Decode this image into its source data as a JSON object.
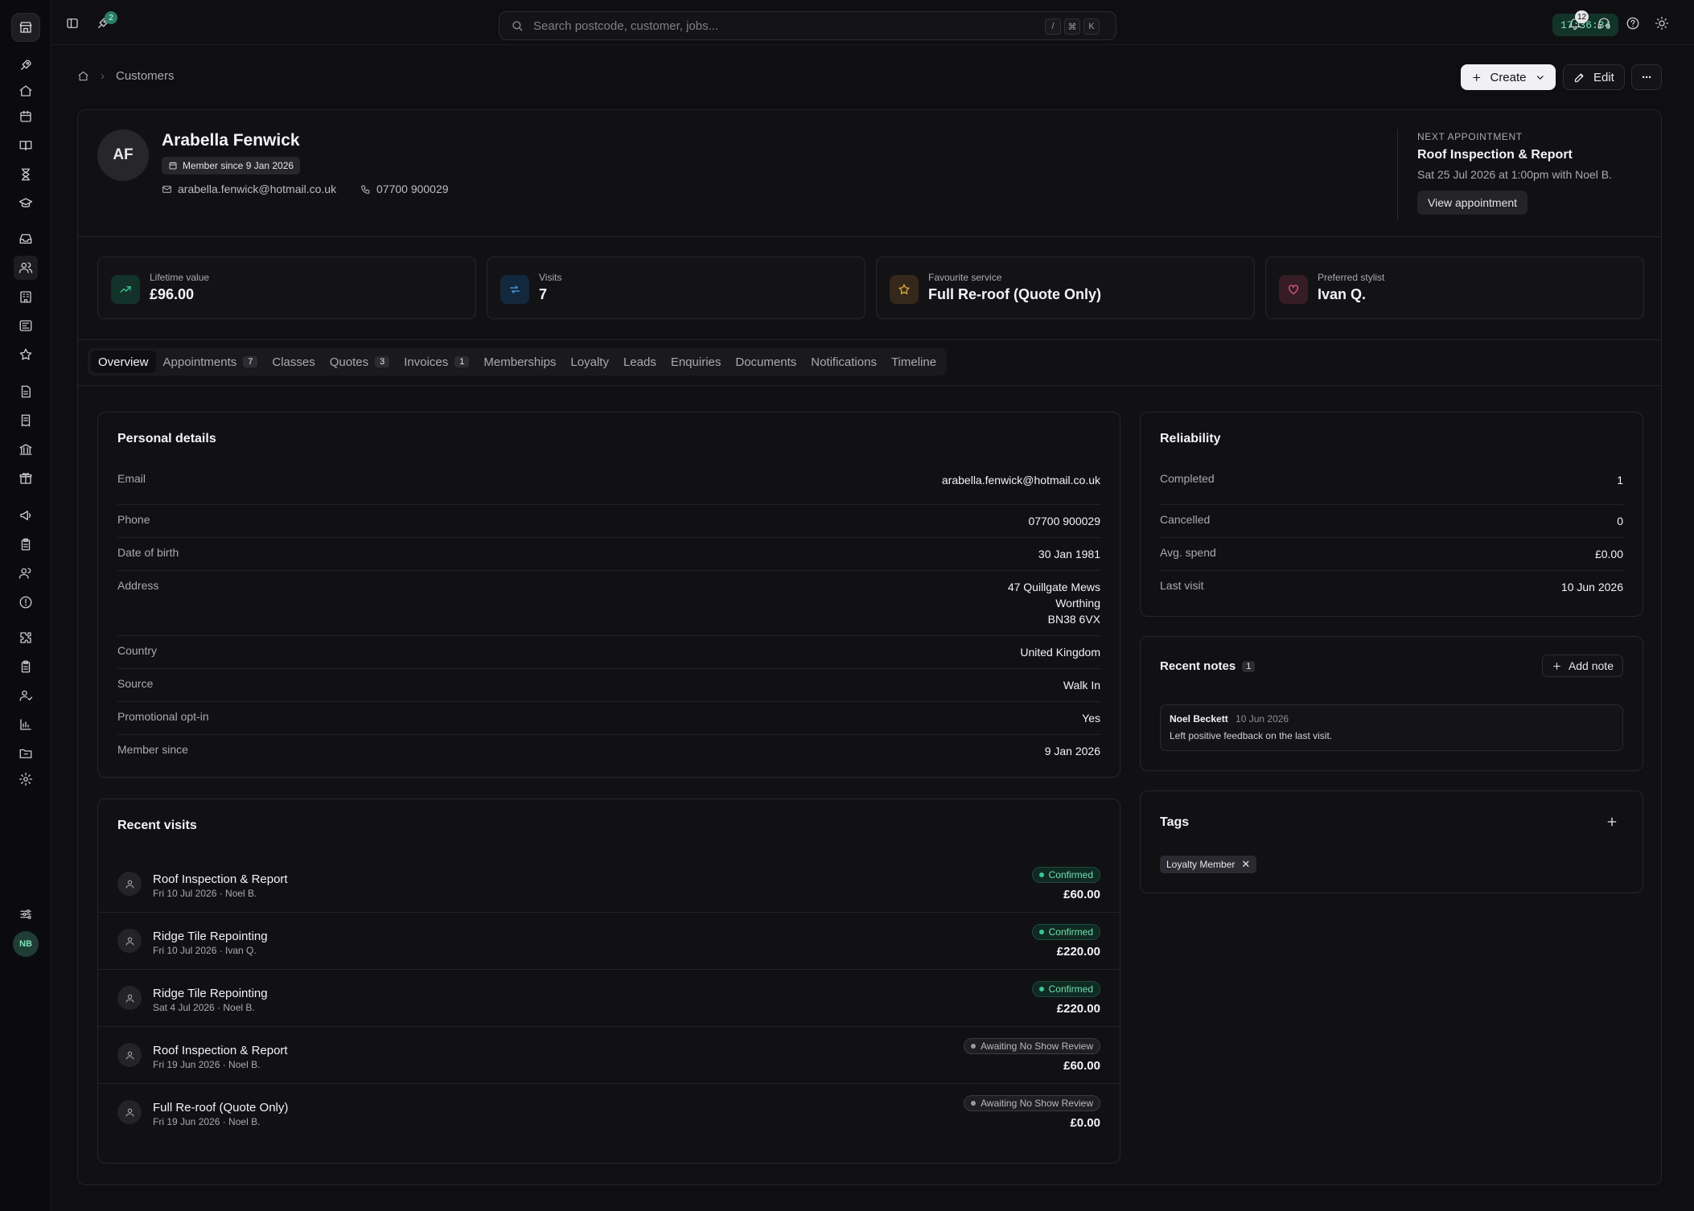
{
  "topbar": {
    "notif_badge_left": "2",
    "search_placeholder": "Search postcode, customer, jobs...",
    "kbd": [
      "/",
      "⌘",
      "K"
    ],
    "clock": "17:36:34",
    "bell_count": "12"
  },
  "breadcrumb": {
    "current": "Customers"
  },
  "actions": {
    "create": "Create",
    "edit": "Edit",
    "more": "···"
  },
  "customer": {
    "initials": "AF",
    "name": "Arabella Fenwick",
    "member_since_badge": "Member since 9 Jan 2026",
    "email": "arabella.fenwick@hotmail.co.uk",
    "phone": "07700 900029"
  },
  "next_appointment": {
    "label": "NEXT APPOINTMENT",
    "title": "Roof Inspection & Report",
    "when": "Sat 25 Jul 2026 at 1:00pm with Noel B.",
    "button": "View appointment"
  },
  "stats": [
    {
      "label": "Lifetime value",
      "value": "£96.00",
      "icon": "trending-up-icon",
      "color": "#3ec48f"
    },
    {
      "label": "Visits",
      "value": "7",
      "icon": "repeat-icon",
      "color": "#4aa3e8"
    },
    {
      "label": "Favourite service",
      "value": "Full Re-roof (Quote Only)",
      "icon": "star-icon",
      "color": "#e0a83e"
    },
    {
      "label": "Preferred stylist",
      "value": "Ivan Q.",
      "icon": "heart-icon",
      "color": "#e05a78"
    }
  ],
  "tabs": [
    {
      "label": "Overview",
      "count": ""
    },
    {
      "label": "Appointments",
      "count": "7"
    },
    {
      "label": "Classes",
      "count": ""
    },
    {
      "label": "Quotes",
      "count": "3"
    },
    {
      "label": "Invoices",
      "count": "1"
    },
    {
      "label": "Memberships",
      "count": ""
    },
    {
      "label": "Loyalty",
      "count": ""
    },
    {
      "label": "Leads",
      "count": ""
    },
    {
      "label": "Enquiries",
      "count": ""
    },
    {
      "label": "Documents",
      "count": ""
    },
    {
      "label": "Notifications",
      "count": ""
    },
    {
      "label": "Timeline",
      "count": ""
    }
  ],
  "personal": {
    "title": "Personal details",
    "rows": [
      {
        "k": "Email",
        "v": "arabella.fenwick@hotmail.co.uk"
      },
      {
        "k": "Phone",
        "v": "07700 900029"
      },
      {
        "k": "Date of birth",
        "v": "30 Jan 1981"
      },
      {
        "k": "Address",
        "v1": "47 Quillgate Mews",
        "v2": "Worthing",
        "v3": "BN38 6VX"
      },
      {
        "k": "Country",
        "v": "United Kingdom"
      },
      {
        "k": "Source",
        "v": "Walk In"
      },
      {
        "k": "Promotional opt-in",
        "v": "Yes"
      },
      {
        "k": "Member since",
        "v": "9 Jan 2026"
      }
    ]
  },
  "visits": {
    "title": "Recent visits",
    "items": [
      {
        "title": "Roof Inspection & Report",
        "sub": "Fri 10 Jul 2026 · Noel B.",
        "status": "Confirmed",
        "price": "£60.00"
      },
      {
        "title": "Ridge Tile Repointing",
        "sub": "Fri 10 Jul 2026 · Ivan Q.",
        "status": "Confirmed",
        "price": "£220.00"
      },
      {
        "title": "Ridge Tile Repointing",
        "sub": "Sat 4 Jul 2026 · Noel B.",
        "status": "Confirmed",
        "price": "£220.00"
      },
      {
        "title": "Roof Inspection & Report",
        "sub": "Fri 19 Jun 2026 · Noel B.",
        "status": "Awaiting No Show Review",
        "price": "£60.00"
      },
      {
        "title": "Full Re-roof (Quote Only)",
        "sub": "Fri 19 Jun 2026 · Noel B.",
        "status": "Awaiting No Show Review",
        "price": "£0.00"
      }
    ]
  },
  "reliability": {
    "title": "Reliability",
    "rows": [
      {
        "k": "Completed",
        "v": "1"
      },
      {
        "k": "Cancelled",
        "v": "0"
      },
      {
        "k": "Avg. spend",
        "v": "£0.00"
      },
      {
        "k": "Last visit",
        "v": "10 Jun 2026"
      }
    ]
  },
  "notes": {
    "title": "Recent notes",
    "count": "1",
    "add": "Add note",
    "items": [
      {
        "author": "Noel Beckett",
        "date": "10 Jun 2026",
        "text": "Left positive feedback on the last visit."
      }
    ]
  },
  "tags": {
    "title": "Tags",
    "items": [
      "Loyalty Member"
    ]
  },
  "user": {
    "initials": "NB"
  }
}
